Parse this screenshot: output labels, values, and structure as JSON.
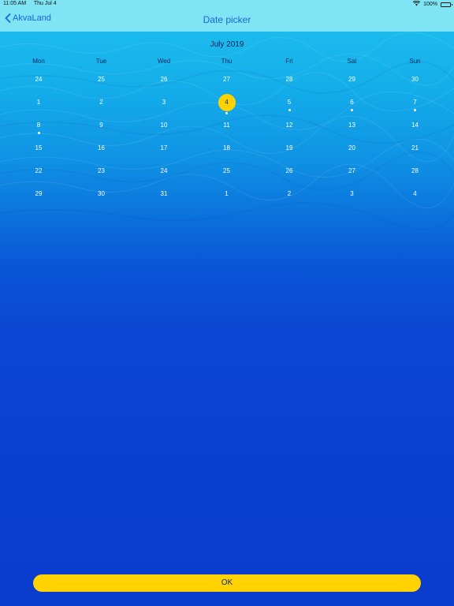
{
  "status_bar": {
    "time": "11:05 AM",
    "date": "Thu Jul 4",
    "battery": "100%",
    "battery_level": 1.0
  },
  "nav": {
    "back_label": "AkvaLand",
    "title": "Date picker"
  },
  "calendar": {
    "month_title": "July 2019",
    "weekdays": [
      "Mon",
      "Tue",
      "Wed",
      "Thu",
      "Fri",
      "Sat",
      "Sun"
    ],
    "weeks": [
      [
        {
          "day": "24",
          "dot": false
        },
        {
          "day": "25",
          "dot": false
        },
        {
          "day": "26",
          "dot": false
        },
        {
          "day": "27",
          "dot": false
        },
        {
          "day": "28",
          "dot": false
        },
        {
          "day": "29",
          "dot": false
        },
        {
          "day": "30",
          "dot": false
        }
      ],
      [
        {
          "day": "1",
          "dot": false
        },
        {
          "day": "2",
          "dot": false
        },
        {
          "day": "3",
          "dot": false
        },
        {
          "day": "4",
          "dot": true,
          "selected": true
        },
        {
          "day": "5",
          "dot": true
        },
        {
          "day": "6",
          "dot": true
        },
        {
          "day": "7",
          "dot": true
        }
      ],
      [
        {
          "day": "8",
          "dot": true
        },
        {
          "day": "9",
          "dot": false
        },
        {
          "day": "10",
          "dot": false
        },
        {
          "day": "11",
          "dot": false
        },
        {
          "day": "12",
          "dot": false
        },
        {
          "day": "13",
          "dot": false
        },
        {
          "day": "14",
          "dot": false
        }
      ],
      [
        {
          "day": "15",
          "dot": false
        },
        {
          "day": "16",
          "dot": false
        },
        {
          "day": "17",
          "dot": false
        },
        {
          "day": "18",
          "dot": false
        },
        {
          "day": "19",
          "dot": false
        },
        {
          "day": "20",
          "dot": false
        },
        {
          "day": "21",
          "dot": false
        }
      ],
      [
        {
          "day": "22",
          "dot": false
        },
        {
          "day": "23",
          "dot": false
        },
        {
          "day": "24",
          "dot": false
        },
        {
          "day": "25",
          "dot": false
        },
        {
          "day": "26",
          "dot": false
        },
        {
          "day": "27",
          "dot": false
        },
        {
          "day": "28",
          "dot": false
        }
      ],
      [
        {
          "day": "29",
          "dot": false
        },
        {
          "day": "30",
          "dot": false
        },
        {
          "day": "31",
          "dot": false
        },
        {
          "day": "1",
          "dot": false
        },
        {
          "day": "2",
          "dot": false
        },
        {
          "day": "3",
          "dot": false
        },
        {
          "day": "4",
          "dot": false
        }
      ]
    ]
  },
  "ok_label": "OK",
  "colors": {
    "bar_bg": "#7fe4f4",
    "accent": "#1d63d8",
    "selected": "#ffd200",
    "water_deep": "#0a3ccc"
  },
  "icons": {
    "back": "chevron-left-icon",
    "wifi": "wifi-icon",
    "battery": "battery-icon"
  }
}
